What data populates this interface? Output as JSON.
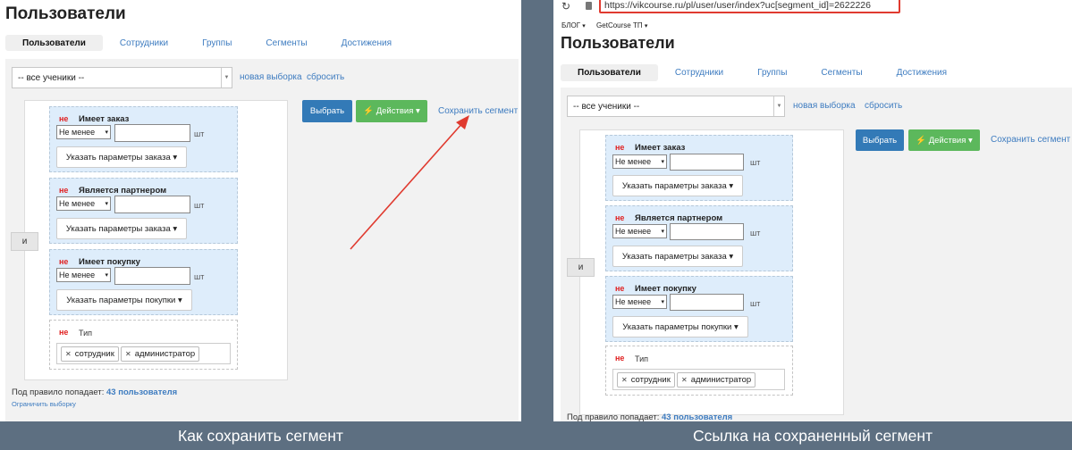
{
  "left_panel": {
    "page_title": "Пользователи",
    "tabs": [
      {
        "label": "Пользователи",
        "active": true
      },
      {
        "label": "Сотрудники",
        "active": false
      },
      {
        "label": "Группы",
        "active": false
      },
      {
        "label": "Сегменты",
        "active": false
      },
      {
        "label": "Достижения",
        "active": false
      }
    ],
    "filter_select": "-- все ученики --",
    "new_selection_link": "новая выборка",
    "reset_link": "сбросить",
    "and_button": "и",
    "blocks": [
      {
        "not_label": "не",
        "title": "Имеет заказ",
        "comparator": "Не менее",
        "unit": "шт",
        "params_button": "Указать параметры заказа"
      },
      {
        "not_label": "не",
        "title": "Является партнером",
        "comparator": "Не менее",
        "unit": "шт",
        "params_button": "Указать параметры заказа"
      },
      {
        "not_label": "не",
        "title": "Имеет покупку",
        "comparator": "Не менее",
        "unit": "шт",
        "params_button": "Указать параметры покупки"
      }
    ],
    "type_block": {
      "not_label": "не",
      "title": "Тип",
      "tags": [
        "сотрудник",
        "администратор"
      ]
    },
    "choose_button": "Выбрать",
    "actions_button": "Действия",
    "save_segment_link": "Сохранить сегмент",
    "count_prefix": "Под правило попадает:",
    "count_value": "43 пользователя",
    "limit_link": "Ограничить выборку",
    "arrow_color": "#e03a2f"
  },
  "right_panel": {
    "browser": {
      "url": "https://vikcourse.ru/pl/user/user/index?uc[segment_id]=2622226",
      "bookmarks": [
        "БЛОГ",
        "GetCourse ТП"
      ]
    },
    "page_title": "Пользователи",
    "tabs": [
      {
        "label": "Пользователи",
        "active": true
      },
      {
        "label": "Сотрудники",
        "active": false
      },
      {
        "label": "Группы",
        "active": false
      },
      {
        "label": "Сегменты",
        "active": false
      },
      {
        "label": "Достижения",
        "active": false
      }
    ],
    "filter_select": "-- все ученики --",
    "new_selection_link": "новая выборка",
    "reset_link": "сбросить",
    "and_button": "и",
    "blocks": [
      {
        "not_label": "не",
        "title": "Имеет заказ",
        "comparator": "Не менее",
        "unit": "шт",
        "params_button": "Указать параметры заказа"
      },
      {
        "not_label": "не",
        "title": "Является партнером",
        "comparator": "Не менее",
        "unit": "шт",
        "params_button": "Указать параметры заказа"
      },
      {
        "not_label": "не",
        "title": "Имеет покупку",
        "comparator": "Не менее",
        "unit": "шт",
        "params_button": "Указать параметры покупки"
      }
    ],
    "type_block": {
      "not_label": "не",
      "title": "Тип",
      "tags": [
        "сотрудник",
        "администратор"
      ]
    },
    "choose_button": "Выбрать",
    "actions_button": "Действия",
    "save_segment_link": "Сохранить сегмент",
    "count_prefix": "Под правило попадает:",
    "count_value": "43 пользователя",
    "url_highlight_color": "#e03a2f"
  },
  "captions": {
    "left": "Как сохранить сегмент",
    "right": "Ссылка на сохраненный сегмент"
  }
}
